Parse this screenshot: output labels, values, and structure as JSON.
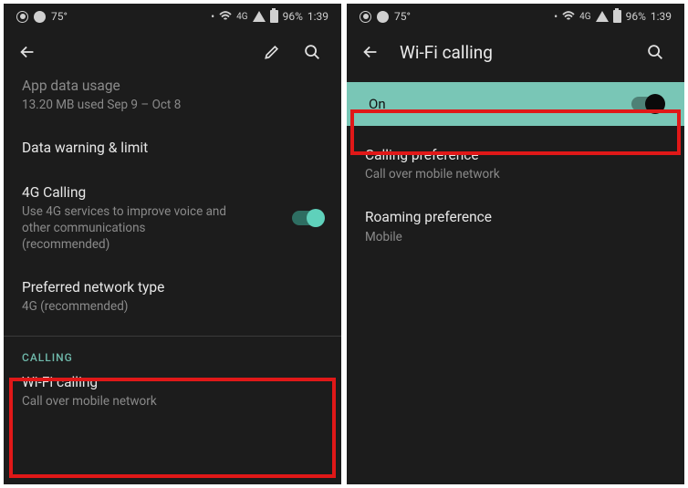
{
  "status": {
    "temp": "75°",
    "net_label": "4G",
    "battery": "96%",
    "time": "1:39"
  },
  "screen1": {
    "app_data_title": "App data usage",
    "app_data_sub": "13.20 MB used Sep 9 – Oct 8",
    "warn_title": "Data warning & limit",
    "fourg_title": "4G Calling",
    "fourg_sub": "Use 4G services to improve voice and other communications (recommended)",
    "preferred_title": "Preferred network type",
    "preferred_sub": "4G (recommended)",
    "section_calling": "CALLING",
    "wifi_title": "Wi-Fi calling",
    "wifi_sub": "Call over mobile network"
  },
  "screen2": {
    "header": "Wi-Fi calling",
    "on_label": "On",
    "calling_pref_title": "Calling preference",
    "calling_pref_sub": "Call over mobile network",
    "roaming_title": "Roaming preference",
    "roaming_sub": "Mobile"
  }
}
